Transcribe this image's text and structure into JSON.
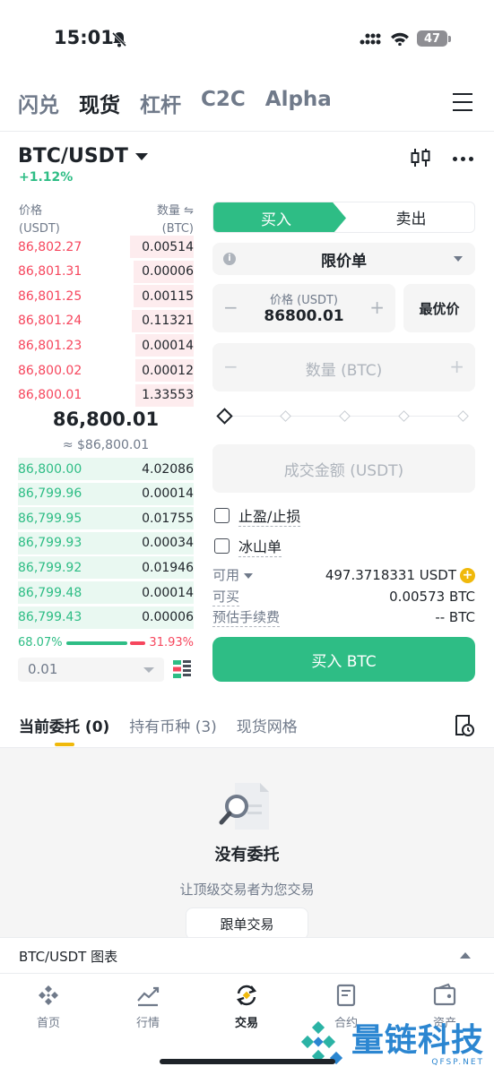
{
  "status_bar": {
    "time": "15:01",
    "battery": "47"
  },
  "top_tabs": [
    "闪兑",
    "现货",
    "杠杆",
    "C2C",
    "Alpha"
  ],
  "top_tab_active": 1,
  "pair": {
    "name": "BTC/USDT",
    "change": "+1.12%"
  },
  "order_book": {
    "price_label": "价格",
    "price_unit": "(USDT)",
    "qty_label": "数量 ⇋",
    "qty_unit": "(BTC)",
    "asks": [
      {
        "price": "86,802.27",
        "qty": "0.00514",
        "depth": 0.36
      },
      {
        "price": "86,801.31",
        "qty": "0.00006",
        "depth": 0.34
      },
      {
        "price": "86,801.25",
        "qty": "0.00115",
        "depth": 0.34
      },
      {
        "price": "86,801.24",
        "qty": "0.11321",
        "depth": 0.35
      },
      {
        "price": "86,801.23",
        "qty": "0.00014",
        "depth": 0.33
      },
      {
        "price": "86,800.02",
        "qty": "0.00012",
        "depth": 0.33
      },
      {
        "price": "86,800.01",
        "qty": "1.33553",
        "depth": 0.33
      }
    ],
    "mid_price": "86,800.01",
    "mid_usd": "≈ $86,800.01",
    "bids": [
      {
        "price": "86,800.00",
        "qty": "4.02086",
        "depth": 1.0
      },
      {
        "price": "86,799.96",
        "qty": "0.00014",
        "depth": 1.0
      },
      {
        "price": "86,799.95",
        "qty": "0.01755",
        "depth": 1.0
      },
      {
        "price": "86,799.93",
        "qty": "0.00034",
        "depth": 1.0
      },
      {
        "price": "86,799.92",
        "qty": "0.01946",
        "depth": 1.0
      },
      {
        "price": "86,799.48",
        "qty": "0.00014",
        "depth": 1.0
      },
      {
        "price": "86,799.43",
        "qty": "0.00006",
        "depth": 1.0
      }
    ],
    "buy_ratio": "68.07%",
    "sell_ratio": "31.93%",
    "buy_ratio_value": 68.07,
    "step": "0.01"
  },
  "trade": {
    "buy_tab": "买入",
    "sell_tab": "卖出",
    "order_type": "限价单",
    "info": "i",
    "price_label": "价格 (USDT)",
    "price_value": "86800.01",
    "minus": "−",
    "plus": "+",
    "best_price": "最优价",
    "qty_placeholder": "数量 (BTC)",
    "total_placeholder": "成交金额 (USDT)",
    "tp_sl": "止盈/止损",
    "iceberg": "冰山单",
    "available_label": "可用",
    "available_value": "497.3718331 USDT",
    "can_buy_label": "可买",
    "can_buy_value": "0.00573 BTC",
    "fee_label": "预估手续费",
    "fee_value": "-- BTC",
    "buy_button": "买入 BTC",
    "plus_coin": "+"
  },
  "orders": {
    "tabs": [
      "当前委托 (0)",
      "持有币种 (3)",
      "现货网格"
    ],
    "active": 0,
    "empty_title": "没有委托",
    "empty_sub": "让顶级交易者为您交易",
    "copy_trade": "跟单交易"
  },
  "chart_bar": {
    "title": "BTC/USDT 图表"
  },
  "bottom_nav": [
    {
      "label": "首页",
      "icon": "binance-logo-icon"
    },
    {
      "label": "行情",
      "icon": "market-chart-icon"
    },
    {
      "label": "交易",
      "icon": "trade-swap-icon"
    },
    {
      "label": "合约",
      "icon": "futures-doc-icon"
    },
    {
      "label": "资产",
      "icon": "wallet-icon"
    }
  ],
  "nav_active": 2,
  "watermark": {
    "text": "量链科技",
    "sub": "QFSP.NET"
  },
  "colors": {
    "green": "#2ebd85",
    "red": "#f6465d",
    "yellow": "#f0b90b",
    "text": "#1e2329",
    "muted": "#707a8a"
  }
}
